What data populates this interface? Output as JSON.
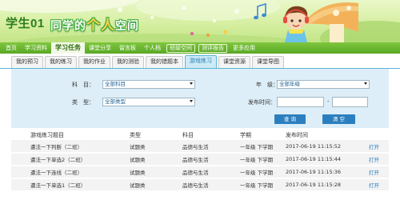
{
  "header": {
    "user_name": "学生01",
    "space_title_part1": "同学的",
    "space_title_part2": "个人",
    "space_title_part3": "空间"
  },
  "main_nav": [
    {
      "label": "首页",
      "active": false
    },
    {
      "label": "学习资料",
      "active": false
    },
    {
      "label": "学习任务",
      "active": true
    },
    {
      "label": "课堂分享",
      "active": false
    },
    {
      "label": "留言板",
      "active": false
    },
    {
      "label": "个人档",
      "active": false
    },
    {
      "label": "班级空间",
      "active": false
    },
    {
      "label": "测评报告",
      "active": false
    },
    {
      "label": "更多应用",
      "active": false
    }
  ],
  "sub_tabs": [
    {
      "label": "我的预习",
      "active": false
    },
    {
      "label": "我的练习",
      "active": false
    },
    {
      "label": "我的作业",
      "active": false
    },
    {
      "label": "我的测验",
      "active": false
    },
    {
      "label": "我的错题本",
      "active": false
    },
    {
      "label": "游戏练习",
      "active": true
    },
    {
      "label": "课堂资源",
      "active": false
    },
    {
      "label": "课堂导图",
      "active": false
    }
  ],
  "filters": {
    "subject_label": "科　目：",
    "subject_value": "全部科目",
    "grade_label": "年　级：",
    "grade_value": "全部年级",
    "type_label": "类　型：",
    "type_value": "全部类型",
    "date_label": "发布时间：",
    "date_separator": "-",
    "search_button": "查 询",
    "clear_button": "清 空"
  },
  "table": {
    "columns": [
      "游戏练习题目",
      "类型",
      "科目",
      "学期",
      "发布时间",
      ""
    ],
    "rows": [
      {
        "title": "遭法一下判断（二班）",
        "type": "试题类",
        "subject": "品德与生活",
        "term": "一年级 下学期",
        "published": "2017-06-19 11:15:52",
        "action": "打开"
      },
      {
        "title": "遭法一下单选2（二班）",
        "type": "试题类",
        "subject": "品德与生活",
        "term": "一年级 下学期",
        "published": "2017-06-19 11:15:44",
        "action": "打开"
      },
      {
        "title": "遭法一下连线（二班）",
        "type": "试题类",
        "subject": "品德与生活",
        "term": "一年级 下学期",
        "published": "2017-06-19 11:15:36",
        "action": "打开"
      },
      {
        "title": "遭法一下单选1（二班）",
        "type": "试题类",
        "subject": "品德与生活",
        "term": "一年级 下学期",
        "published": "2017-06-19 11:15:28",
        "action": "打开"
      }
    ]
  },
  "colors": {
    "nav_green": "#5aa826",
    "tab_active_blue": "#cdeaf6",
    "panel_blue": "#ddeef8",
    "button_blue": "#2c7fbf",
    "link_blue": "#2a7fc0"
  },
  "icons": [
    "music-note-icon",
    "select-arrow-icon"
  ]
}
